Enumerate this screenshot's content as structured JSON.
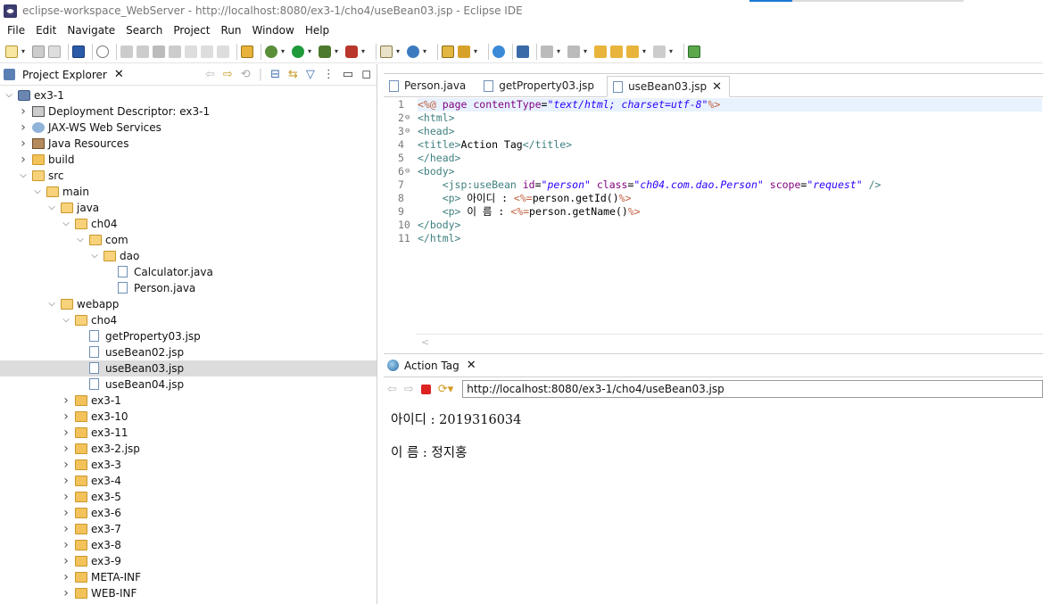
{
  "window": {
    "title": "eclipse-workspace_WebServer - http://localhost:8080/ex3-1/cho4/useBean03.jsp - Eclipse IDE"
  },
  "menu": [
    "File",
    "Edit",
    "Navigate",
    "Search",
    "Project",
    "Run",
    "Window",
    "Help"
  ],
  "explorer": {
    "title": "Project Explorer",
    "rows": [
      {
        "label": "ex3-1",
        "level": 0,
        "expanded": true,
        "icon": "project-icon"
      },
      {
        "label": "Deployment Descriptor: ex3-1",
        "level": 1,
        "expanded": false,
        "icon": "deployment-descriptor-icon"
      },
      {
        "label": "JAX-WS Web Services",
        "level": 1,
        "expanded": false,
        "icon": "web-services-icon"
      },
      {
        "label": "Java Resources",
        "level": 1,
        "expanded": false,
        "icon": "java-resources-icon"
      },
      {
        "label": "build",
        "level": 1,
        "expanded": false,
        "icon": "folder-icon"
      },
      {
        "label": "src",
        "level": 1,
        "expanded": true,
        "icon": "folder-icon"
      },
      {
        "label": "main",
        "level": 2,
        "expanded": true,
        "icon": "folder-icon"
      },
      {
        "label": "java",
        "level": 3,
        "expanded": true,
        "icon": "folder-icon"
      },
      {
        "label": "ch04",
        "level": 4,
        "expanded": true,
        "icon": "folder-icon"
      },
      {
        "label": "com",
        "level": 5,
        "expanded": true,
        "icon": "folder-icon"
      },
      {
        "label": "dao",
        "level": 6,
        "expanded": true,
        "icon": "folder-icon"
      },
      {
        "label": "Calculator.java",
        "level": 7,
        "icon": "java-file-icon"
      },
      {
        "label": "Person.java",
        "level": 7,
        "icon": "java-file-icon"
      },
      {
        "label": "webapp",
        "level": 3,
        "expanded": true,
        "icon": "folder-icon"
      },
      {
        "label": "cho4",
        "level": 4,
        "expanded": true,
        "icon": "folder-icon"
      },
      {
        "label": "getProperty03.jsp",
        "level": 5,
        "icon": "jsp-file-icon"
      },
      {
        "label": "useBean02.jsp",
        "level": 5,
        "icon": "jsp-file-icon"
      },
      {
        "label": "useBean03.jsp",
        "level": 5,
        "icon": "jsp-file-icon",
        "selected": true
      },
      {
        "label": "useBean04.jsp",
        "level": 5,
        "icon": "jsp-file-icon"
      },
      {
        "label": "ex3-1",
        "level": 4,
        "expanded": false,
        "icon": "folder-icon"
      },
      {
        "label": "ex3-10",
        "level": 4,
        "expanded": false,
        "icon": "folder-icon"
      },
      {
        "label": "ex3-11",
        "level": 4,
        "expanded": false,
        "icon": "folder-icon"
      },
      {
        "label": "ex3-2.jsp",
        "level": 4,
        "expanded": false,
        "icon": "folder-icon"
      },
      {
        "label": "ex3-3",
        "level": 4,
        "expanded": false,
        "icon": "folder-icon"
      },
      {
        "label": "ex3-4",
        "level": 4,
        "expanded": false,
        "icon": "folder-icon"
      },
      {
        "label": "ex3-5",
        "level": 4,
        "expanded": false,
        "icon": "folder-icon"
      },
      {
        "label": "ex3-6",
        "level": 4,
        "expanded": false,
        "icon": "folder-icon"
      },
      {
        "label": "ex3-7",
        "level": 4,
        "expanded": false,
        "icon": "folder-icon"
      },
      {
        "label": "ex3-8",
        "level": 4,
        "expanded": false,
        "icon": "folder-icon"
      },
      {
        "label": "ex3-9",
        "level": 4,
        "expanded": false,
        "icon": "folder-icon"
      },
      {
        "label": "META-INF",
        "level": 4,
        "expanded": false,
        "icon": "folder-icon"
      },
      {
        "label": "WEB-INF",
        "level": 4,
        "expanded": false,
        "icon": "folder-icon"
      }
    ]
  },
  "editor": {
    "tabs": [
      {
        "label": "Person.java",
        "active": false
      },
      {
        "label": "getProperty03.jsp",
        "active": false
      },
      {
        "label": "useBean03.jsp",
        "active": true
      }
    ],
    "line_numbers": [
      "1",
      "2",
      "3",
      "4",
      "5",
      "6",
      "7",
      "8",
      "9",
      "10",
      "11"
    ],
    "fold_markers": [
      "",
      "⊖",
      "⊖",
      "",
      "",
      "⊖",
      "",
      "",
      "",
      "",
      ""
    ]
  },
  "browser": {
    "tab_label": "Action Tag",
    "url": "http://localhost:8080/ex3-1/cho4/useBean03.jsp",
    "lines": [
      "아이디 : 2019316034",
      "이 름 : 정지홍"
    ]
  }
}
